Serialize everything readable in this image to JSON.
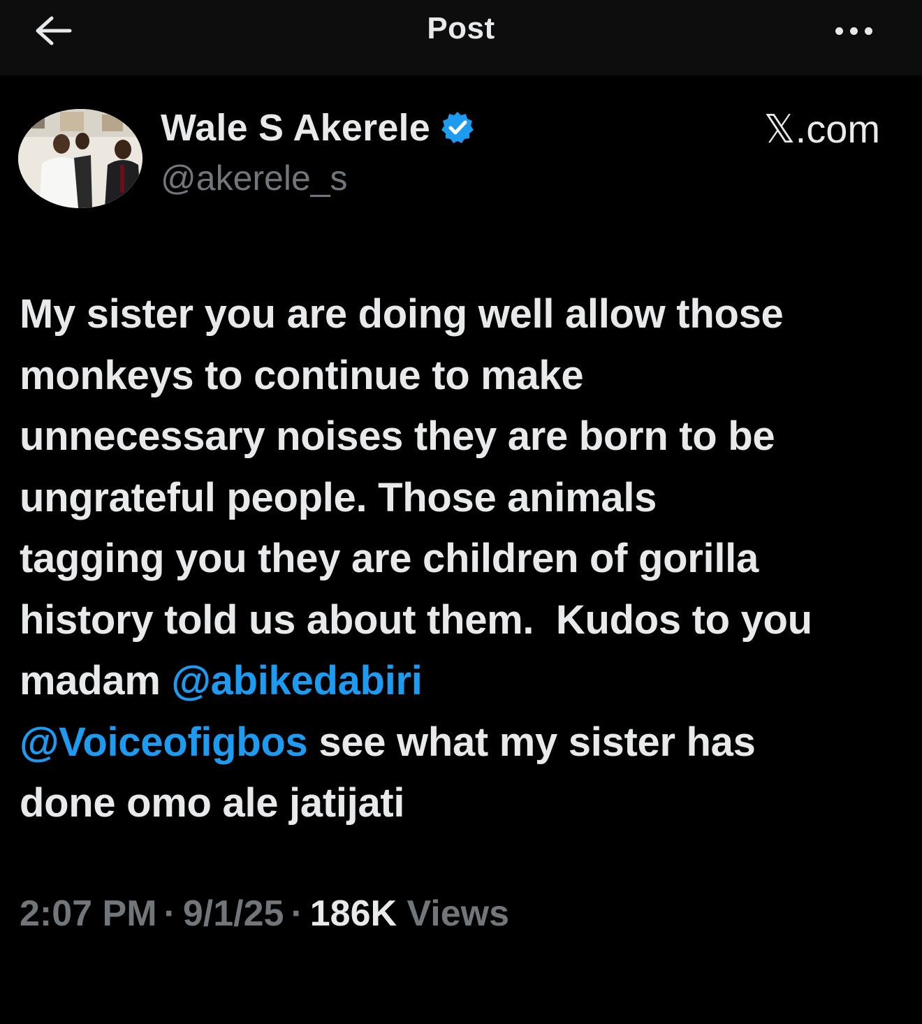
{
  "header": {
    "title": "Post",
    "back_icon": "arrow-left-icon",
    "more_icon": "more-horizontal-icon"
  },
  "author": {
    "name": "Wale S Akerele",
    "handle": "@akerele_s",
    "verified": true,
    "verified_color": "#1d9bf0"
  },
  "watermark": "𝕏.com",
  "tweet": {
    "lines": [
      [
        {
          "text": "My sister you are doing well allow those",
          "type": "text"
        }
      ],
      [
        {
          "text": "monkeys to continue to make",
          "type": "text"
        }
      ],
      [
        {
          "text": "unnecessary noises they are born to be",
          "type": "text"
        }
      ],
      [
        {
          "text": "ungrateful people. Those animals",
          "type": "text"
        }
      ],
      [
        {
          "text": "tagging you they are children of gorilla",
          "type": "text"
        }
      ],
      [
        {
          "text": "history told us about them.  Kudos to you",
          "type": "text"
        }
      ],
      [
        {
          "text": "madam ",
          "type": "text"
        },
        {
          "text": "@abikedabiri",
          "type": "mention"
        }
      ],
      [
        {
          "text": "@Voiceofigbos",
          "type": "mention"
        },
        {
          "text": " see what my sister has",
          "type": "text"
        }
      ],
      [
        {
          "text": "done omo ale jatijati",
          "type": "text"
        }
      ]
    ],
    "mention_color": "#1d9bf0"
  },
  "meta": {
    "time": "2:07 PM",
    "date": "9/1/25",
    "views_count": "186K",
    "views_label": "Views",
    "separator": "·"
  },
  "colors": {
    "background": "#000000",
    "text_primary": "#e7e9ea",
    "text_secondary": "#71767b",
    "accent": "#1d9bf0"
  }
}
